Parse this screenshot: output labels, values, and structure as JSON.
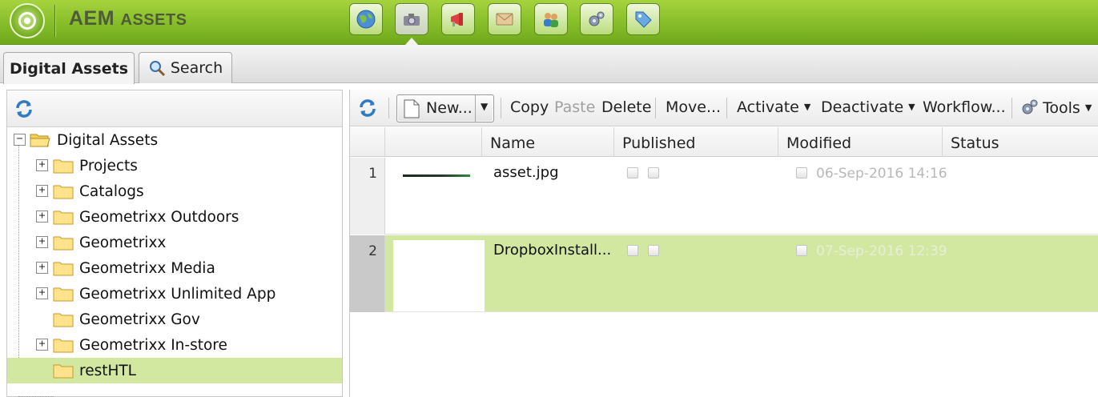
{
  "header": {
    "app_title_prefix": "AEM ",
    "app_title_main": "ASSETS",
    "nav_buttons": [
      {
        "icon": "globe-icon"
      },
      {
        "icon": "camera-icon"
      },
      {
        "icon": "megaphone-icon"
      },
      {
        "icon": "envelope-icon"
      },
      {
        "icon": "users-icon"
      },
      {
        "icon": "gears-icon"
      },
      {
        "icon": "tag-icon"
      }
    ]
  },
  "tabs": [
    {
      "label": "Digital Assets",
      "active": true
    },
    {
      "label": "Search",
      "icon": "magnifier-icon",
      "active": false
    }
  ],
  "tree": {
    "root": "Digital Assets",
    "items": [
      {
        "label": "Projects",
        "expandable": true
      },
      {
        "label": "Catalogs",
        "expandable": true
      },
      {
        "label": "Geometrixx Outdoors",
        "expandable": true
      },
      {
        "label": "Geometrixx",
        "expandable": true
      },
      {
        "label": "Geometrixx Media",
        "expandable": true
      },
      {
        "label": "Geometrixx Unlimited App",
        "expandable": true
      },
      {
        "label": "Geometrixx Gov",
        "expandable": false
      },
      {
        "label": "Geometrixx In-store",
        "expandable": true
      },
      {
        "label": "restHTL",
        "expandable": false,
        "selected": true
      }
    ]
  },
  "toolbar": {
    "new_label": "New...",
    "copy_label": "Copy",
    "paste_label": "Paste",
    "delete_label": "Delete",
    "move_label": "Move...",
    "activate_label": "Activate",
    "deactivate_label": "Deactivate",
    "workflow_label": "Workflow...",
    "tools_label": "Tools"
  },
  "grid": {
    "columns": [
      "Name",
      "Published",
      "Modified",
      "Status"
    ],
    "rows": [
      {
        "num": "1",
        "name": "asset.jpg",
        "modified": "06-Sep-2016 14:16"
      },
      {
        "num": "2",
        "name": "DropboxInstall...",
        "modified": "07-Sep-2016 12:39",
        "selected": true
      }
    ]
  },
  "colors": {
    "header_green": "#8bc12b",
    "selection_green": "#d2e8a0"
  }
}
